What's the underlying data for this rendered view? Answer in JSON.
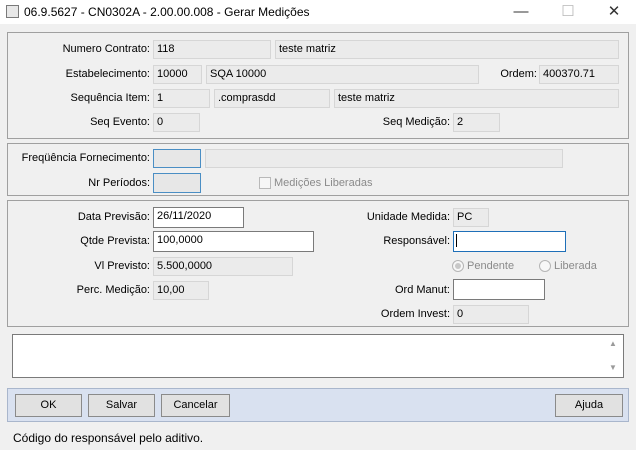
{
  "window": {
    "title": "06.9.5627 - CN0302A - 2.00.00.008 - Gerar Medições",
    "minimize_glyph": "—",
    "maximize_glyph": "☐",
    "close_glyph": "✕"
  },
  "contract": {
    "numero_label": "Numero Contrato:",
    "numero_value": "118",
    "numero_desc": "teste matriz",
    "estab_label": "Estabelecimento:",
    "estab_code": "10000",
    "estab_name": "SQA 10000",
    "ordem_label": "Ordem:",
    "ordem_value": "400370.71",
    "seq_item_label": "Sequência Item:",
    "seq_item_value": "1",
    "item_code": ".comprasdd",
    "item_desc": "teste matriz",
    "seq_evento_label": "Seq Evento:",
    "seq_evento_value": "0",
    "seq_medicao_label": "Seq Medição:",
    "seq_medicao_value": "2"
  },
  "frequency": {
    "freq_label": "Freqüência Fornecimento:",
    "freq_value": "",
    "freq_desc": "",
    "periodos_label": "Nr Períodos:",
    "periodos_value": "",
    "medicoes_label": "Medições Liberadas",
    "medicoes_checked": false
  },
  "measurement": {
    "data_label": "Data Previsão:",
    "data_value": "26/11/2020",
    "qtde_label": "Qtde Prevista:",
    "qtde_value": "100,0000",
    "vl_label": "Vl Previsto:",
    "vl_value": "5.500,0000",
    "perc_label": "Perc. Medição:",
    "perc_value": "10,00",
    "unidade_label": "Unidade Medida:",
    "unidade_value": "PC",
    "resp_label": "Responsável:",
    "resp_value": "",
    "status_options": [
      "Pendente",
      "Liberada"
    ],
    "status_selected": "Pendente",
    "ord_manut_label": "Ord Manut:",
    "ord_manut_value": "",
    "ordem_invest_label": "Ordem Invest:",
    "ordem_invest_value": "0"
  },
  "notes": {
    "value": ""
  },
  "buttons": {
    "ok": "OK",
    "salvar": "Salvar",
    "cancelar": "Cancelar",
    "ajuda": "Ajuda"
  },
  "status_bar": {
    "text": "Código do responsável pelo aditivo."
  }
}
